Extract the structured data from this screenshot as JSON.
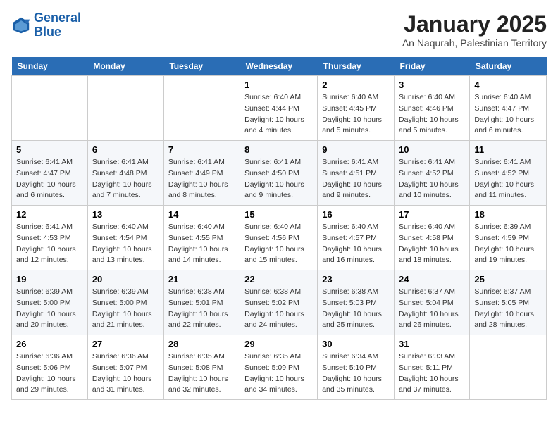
{
  "header": {
    "logo_line1": "General",
    "logo_line2": "Blue",
    "title": "January 2025",
    "subtitle": "An Naqurah, Palestinian Territory"
  },
  "weekdays": [
    "Sunday",
    "Monday",
    "Tuesday",
    "Wednesday",
    "Thursday",
    "Friday",
    "Saturday"
  ],
  "weeks": [
    [
      {
        "day": "",
        "info": ""
      },
      {
        "day": "",
        "info": ""
      },
      {
        "day": "",
        "info": ""
      },
      {
        "day": "1",
        "info": "Sunrise: 6:40 AM\nSunset: 4:44 PM\nDaylight: 10 hours and 4 minutes."
      },
      {
        "day": "2",
        "info": "Sunrise: 6:40 AM\nSunset: 4:45 PM\nDaylight: 10 hours and 5 minutes."
      },
      {
        "day": "3",
        "info": "Sunrise: 6:40 AM\nSunset: 4:46 PM\nDaylight: 10 hours and 5 minutes."
      },
      {
        "day": "4",
        "info": "Sunrise: 6:40 AM\nSunset: 4:47 PM\nDaylight: 10 hours and 6 minutes."
      }
    ],
    [
      {
        "day": "5",
        "info": "Sunrise: 6:41 AM\nSunset: 4:47 PM\nDaylight: 10 hours and 6 minutes."
      },
      {
        "day": "6",
        "info": "Sunrise: 6:41 AM\nSunset: 4:48 PM\nDaylight: 10 hours and 7 minutes."
      },
      {
        "day": "7",
        "info": "Sunrise: 6:41 AM\nSunset: 4:49 PM\nDaylight: 10 hours and 8 minutes."
      },
      {
        "day": "8",
        "info": "Sunrise: 6:41 AM\nSunset: 4:50 PM\nDaylight: 10 hours and 9 minutes."
      },
      {
        "day": "9",
        "info": "Sunrise: 6:41 AM\nSunset: 4:51 PM\nDaylight: 10 hours and 9 minutes."
      },
      {
        "day": "10",
        "info": "Sunrise: 6:41 AM\nSunset: 4:52 PM\nDaylight: 10 hours and 10 minutes."
      },
      {
        "day": "11",
        "info": "Sunrise: 6:41 AM\nSunset: 4:52 PM\nDaylight: 10 hours and 11 minutes."
      }
    ],
    [
      {
        "day": "12",
        "info": "Sunrise: 6:41 AM\nSunset: 4:53 PM\nDaylight: 10 hours and 12 minutes."
      },
      {
        "day": "13",
        "info": "Sunrise: 6:40 AM\nSunset: 4:54 PM\nDaylight: 10 hours and 13 minutes."
      },
      {
        "day": "14",
        "info": "Sunrise: 6:40 AM\nSunset: 4:55 PM\nDaylight: 10 hours and 14 minutes."
      },
      {
        "day": "15",
        "info": "Sunrise: 6:40 AM\nSunset: 4:56 PM\nDaylight: 10 hours and 15 minutes."
      },
      {
        "day": "16",
        "info": "Sunrise: 6:40 AM\nSunset: 4:57 PM\nDaylight: 10 hours and 16 minutes."
      },
      {
        "day": "17",
        "info": "Sunrise: 6:40 AM\nSunset: 4:58 PM\nDaylight: 10 hours and 18 minutes."
      },
      {
        "day": "18",
        "info": "Sunrise: 6:39 AM\nSunset: 4:59 PM\nDaylight: 10 hours and 19 minutes."
      }
    ],
    [
      {
        "day": "19",
        "info": "Sunrise: 6:39 AM\nSunset: 5:00 PM\nDaylight: 10 hours and 20 minutes."
      },
      {
        "day": "20",
        "info": "Sunrise: 6:39 AM\nSunset: 5:00 PM\nDaylight: 10 hours and 21 minutes."
      },
      {
        "day": "21",
        "info": "Sunrise: 6:38 AM\nSunset: 5:01 PM\nDaylight: 10 hours and 22 minutes."
      },
      {
        "day": "22",
        "info": "Sunrise: 6:38 AM\nSunset: 5:02 PM\nDaylight: 10 hours and 24 minutes."
      },
      {
        "day": "23",
        "info": "Sunrise: 6:38 AM\nSunset: 5:03 PM\nDaylight: 10 hours and 25 minutes."
      },
      {
        "day": "24",
        "info": "Sunrise: 6:37 AM\nSunset: 5:04 PM\nDaylight: 10 hours and 26 minutes."
      },
      {
        "day": "25",
        "info": "Sunrise: 6:37 AM\nSunset: 5:05 PM\nDaylight: 10 hours and 28 minutes."
      }
    ],
    [
      {
        "day": "26",
        "info": "Sunrise: 6:36 AM\nSunset: 5:06 PM\nDaylight: 10 hours and 29 minutes."
      },
      {
        "day": "27",
        "info": "Sunrise: 6:36 AM\nSunset: 5:07 PM\nDaylight: 10 hours and 31 minutes."
      },
      {
        "day": "28",
        "info": "Sunrise: 6:35 AM\nSunset: 5:08 PM\nDaylight: 10 hours and 32 minutes."
      },
      {
        "day": "29",
        "info": "Sunrise: 6:35 AM\nSunset: 5:09 PM\nDaylight: 10 hours and 34 minutes."
      },
      {
        "day": "30",
        "info": "Sunrise: 6:34 AM\nSunset: 5:10 PM\nDaylight: 10 hours and 35 minutes."
      },
      {
        "day": "31",
        "info": "Sunrise: 6:33 AM\nSunset: 5:11 PM\nDaylight: 10 hours and 37 minutes."
      },
      {
        "day": "",
        "info": ""
      }
    ]
  ]
}
